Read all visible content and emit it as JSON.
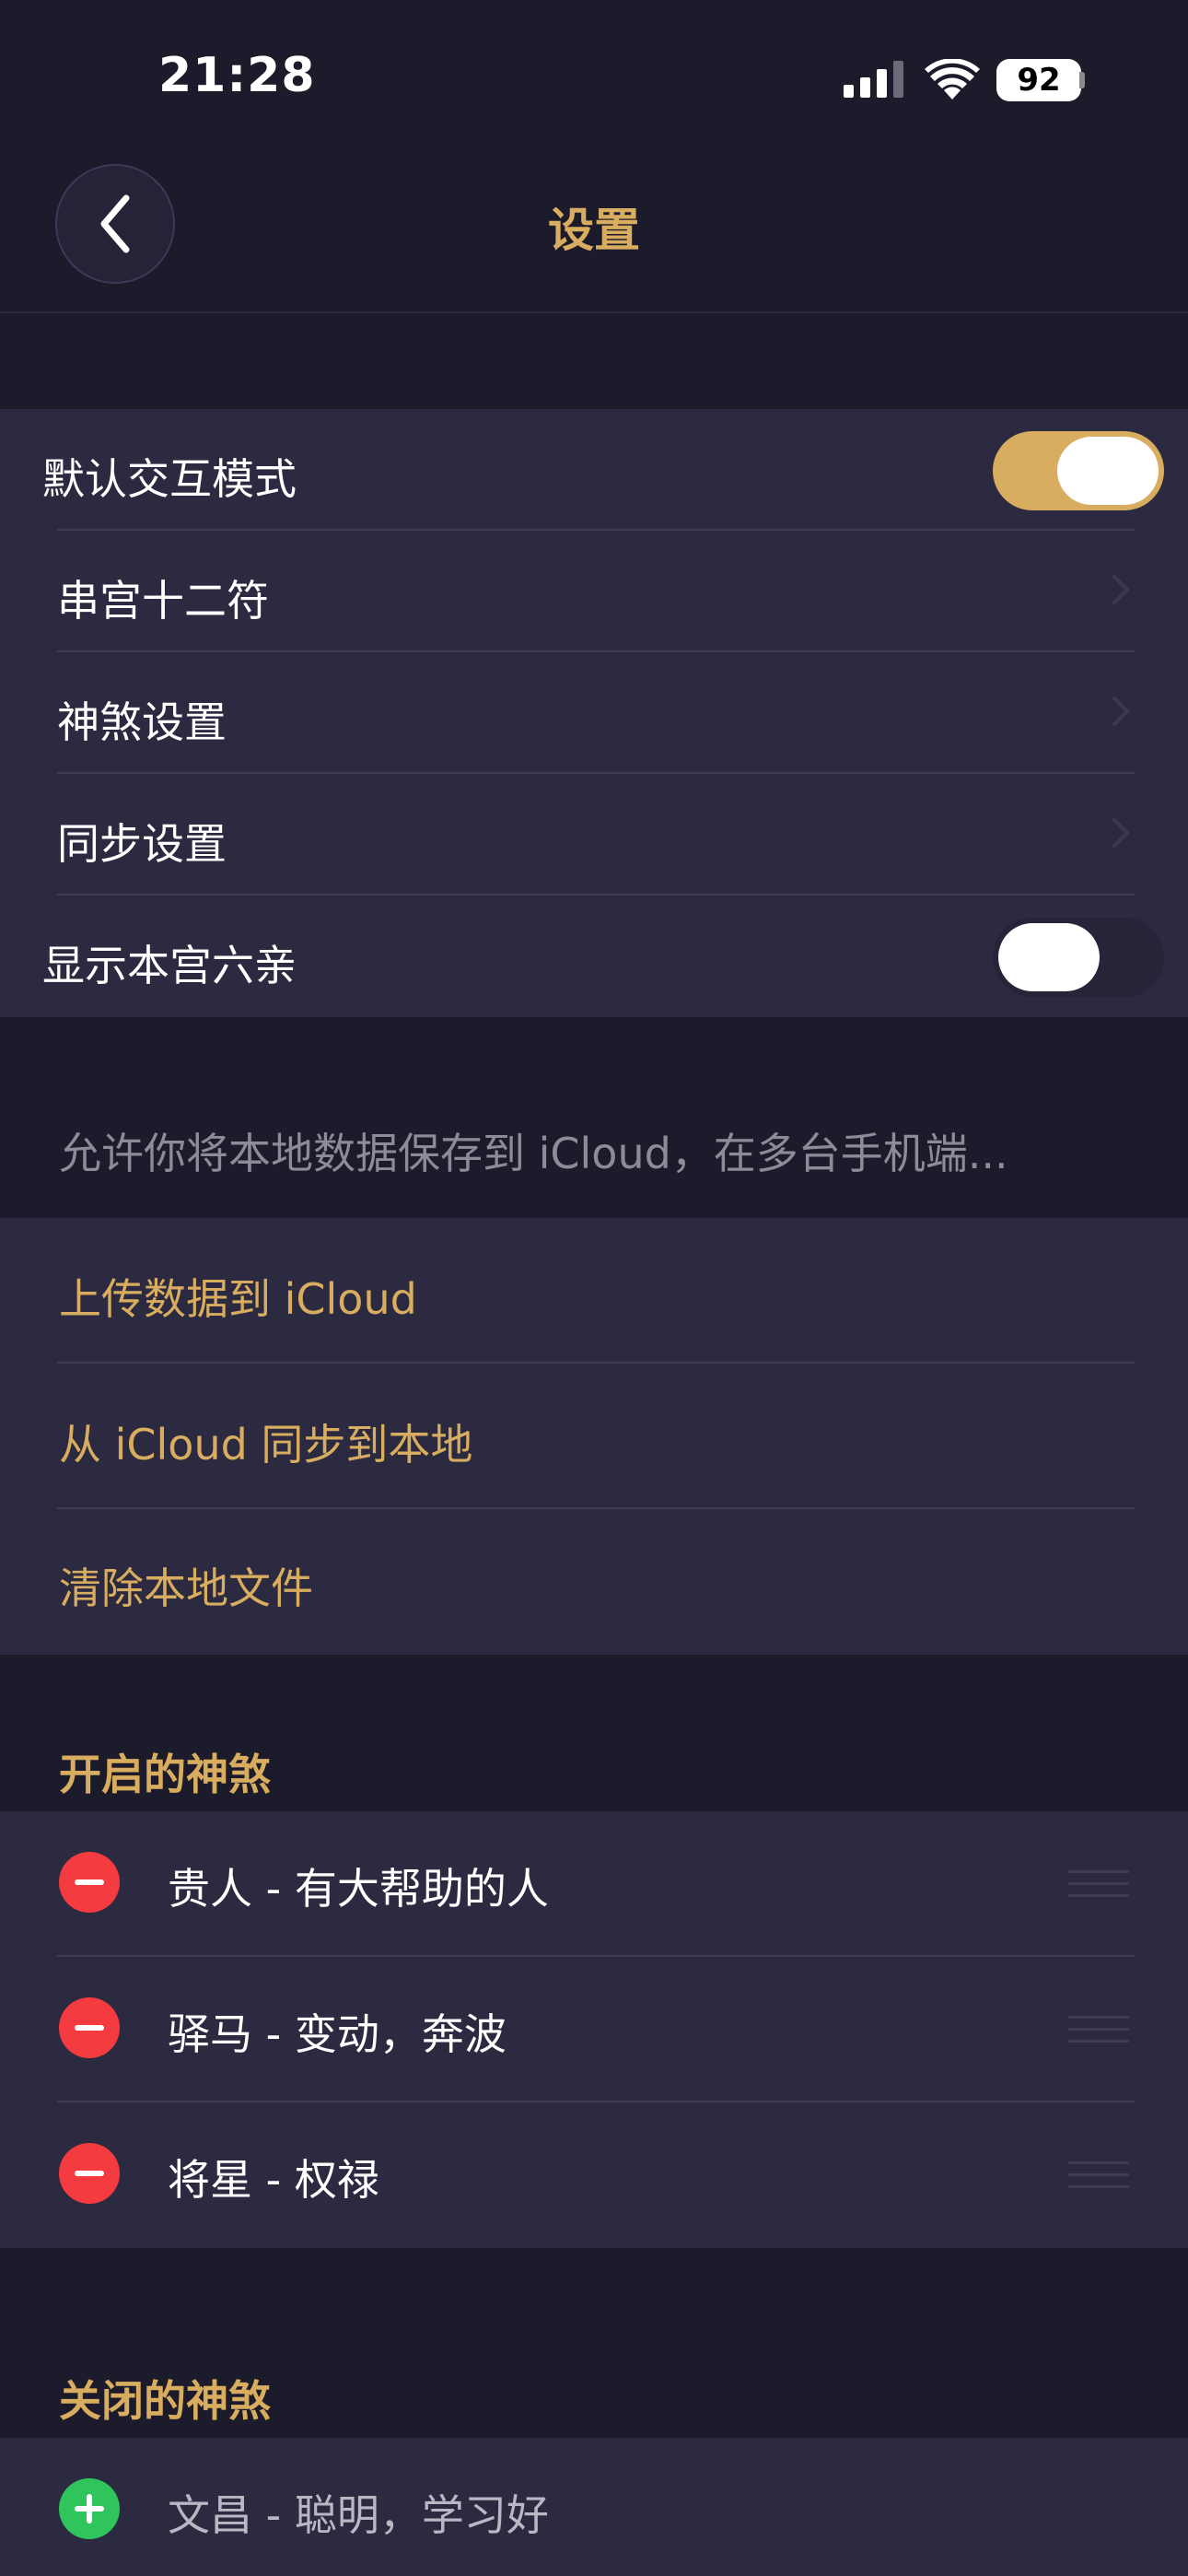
{
  "status_bar": {
    "time": "21:28",
    "battery": "92"
  },
  "nav": {
    "title": "设置"
  },
  "settings": {
    "default_interaction_mode": {
      "label": "默认交互模式",
      "on": true
    },
    "items": [
      {
        "label": "串宫十二符"
      },
      {
        "label": "神煞设置"
      },
      {
        "label": "同步设置"
      }
    ],
    "show_benGong_liuQin": {
      "label": "显示本宫六亲",
      "on": false
    }
  },
  "icloud": {
    "hint": "允许你将本地数据保存到 iCloud，在多台手机端...",
    "actions": [
      {
        "label": "上传数据到 iCloud"
      },
      {
        "label": "从 iCloud 同步到本地"
      },
      {
        "label": "清除本地文件"
      }
    ]
  },
  "enabled_shensha": {
    "header": "开启的神煞",
    "items": [
      {
        "label": "贵人 - 有大帮助的人"
      },
      {
        "label": "驿马 - 变动，奔波"
      },
      {
        "label": "将星 - 权禄"
      }
    ]
  },
  "disabled_shensha": {
    "header": "关闭的神煞",
    "items": [
      {
        "label": "文昌 - 聪明，学习好"
      }
    ]
  },
  "colors": {
    "accent": "#d9ad5f",
    "background": "#1c1b2b",
    "cell": "#2b2a40",
    "remove": "#f43b3f",
    "add": "#2fc45c"
  }
}
